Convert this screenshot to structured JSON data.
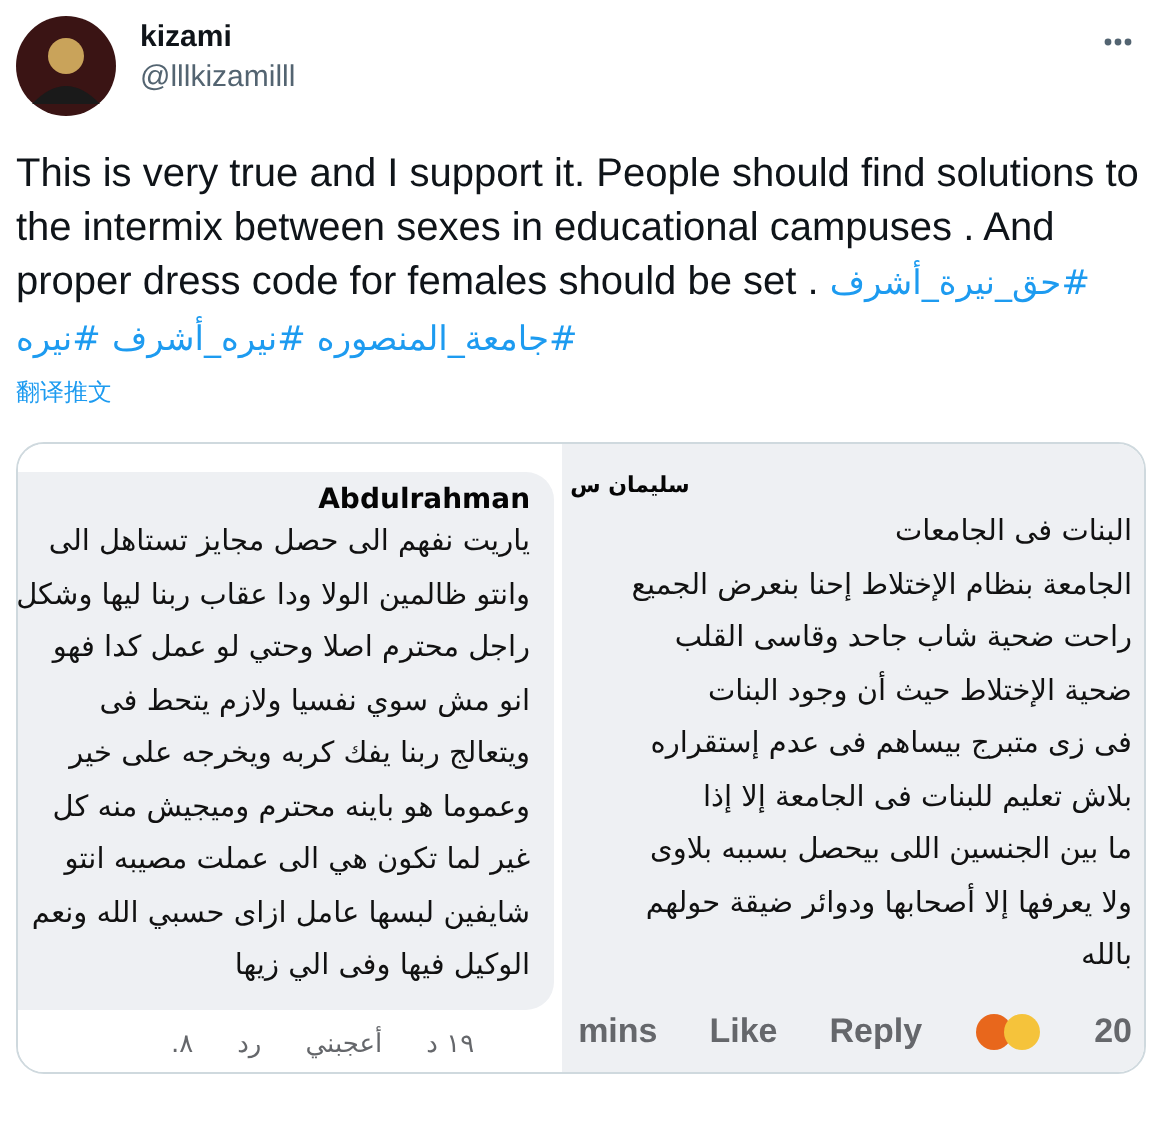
{
  "tweet": {
    "author": {
      "name": "kizami",
      "handle": "@lllkizamilll"
    },
    "text": "This is very true and I support it. People should find solutions to the intermix between sexes in educational campuses  . And proper dress code for females should be set .",
    "hashtags": [
      "#حق_نيرة_أشرف",
      "#جامعة_المنصوره",
      "#نيره_أشرف",
      "#نيره"
    ],
    "translate_link": "翻译推文"
  },
  "image": {
    "panels": [
      {
        "kind": "flat",
        "author": "سليمان س",
        "lines": [
          "البنات فى الجامعات",
          "الجامعة بنظام الإختلاط إحنا بنعرض الجميع",
          "راحت ضحية شاب جاحد وقاسى القلب",
          "ضحية الإختلاط حيث أن وجود البنات",
          "فى زى متبرج بيساهم فى عدم إستقراره",
          "بلاش تعليم للبنات فى الجامعة إلا إذا",
          "ما بين الجنسين اللى بيحصل بسببه بلاوى",
          "ولا يعرفها إلا أصحابها ودوائر ضيقة حولهم",
          "بالله"
        ],
        "footer": {
          "items": [
            {
              "kind": "text",
              "text": "20"
            },
            {
              "kind": "reactions"
            },
            {
              "kind": "text",
              "text": "Reply"
            },
            {
              "kind": "text",
              "text": "Like"
            },
            {
              "kind": "text",
              "text": "mins"
            }
          ]
        }
      },
      {
        "kind": "bubble",
        "author": "Abdulrahman",
        "lines": [
          "ياريت نفهم الى حصل مجايز تستاهل الى",
          "وانتو ظالمين الولا ودا عقاب ربنا ليها وشكل",
          "راجل محترم اصلا وحتي لو عمل كدا فهو",
          "انو مش سوي نفسيا ولازم يتحط فى",
          "ويتعالج ربنا يفك كربه ويخرجه على خير",
          "وعموما هو باينه محترم وميجيش منه كل",
          "غير لما تكون هي الى عملت مصيبه انتو",
          "شايفين لبسها عامل ازاى حسبي الله ونعم",
          "الوكيل فيها وفى الي زيها"
        ],
        "footer": {
          "items": [
            {
              "kind": "text",
              "text": "١٩ د"
            },
            {
              "kind": "text",
              "text": "أعجبني"
            },
            {
              "kind": "text",
              "text": "رد"
            },
            {
              "kind": "text",
              "text": "٨."
            }
          ]
        }
      }
    ]
  }
}
